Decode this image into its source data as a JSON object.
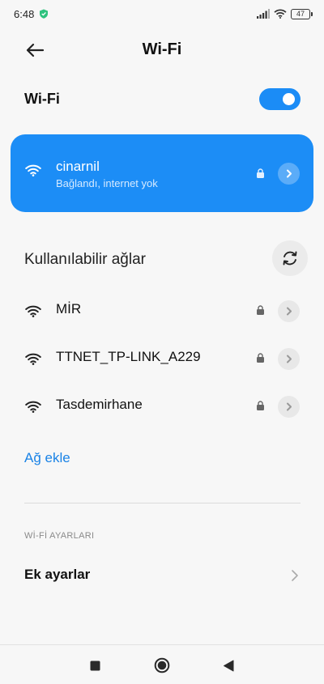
{
  "status_bar": {
    "time": "6:48",
    "battery": "47"
  },
  "header": {
    "title": "Wi-Fi"
  },
  "wifi_toggle": {
    "label": "Wi-Fi",
    "enabled": true
  },
  "connected": {
    "name": "cinarnil",
    "status": "Bağlandı, internet yok"
  },
  "available": {
    "title": "Kullanılabilir ağlar",
    "networks": [
      {
        "name": "MİR",
        "secured": true
      },
      {
        "name": "TTNET_TP-LINK_A229",
        "secured": true
      },
      {
        "name": "Tasdemirhane",
        "secured": true
      }
    ]
  },
  "add_network": "Ağ ekle",
  "settings_section": {
    "label": "Wİ-Fİ AYARLARI",
    "more_settings": "Ek ayarlar"
  },
  "colors": {
    "accent": "#1c8df6",
    "link": "#1a83e6",
    "background": "#f7f7f7"
  }
}
